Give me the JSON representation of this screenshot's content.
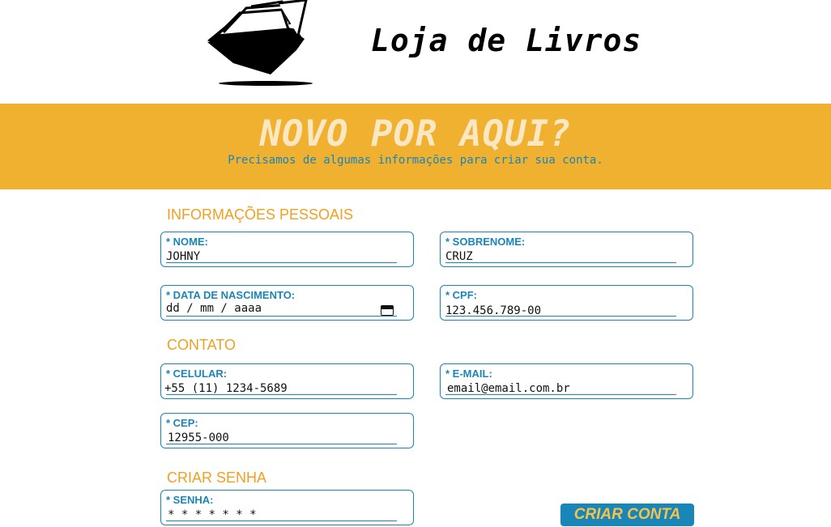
{
  "header": {
    "title": "Loja de Livros"
  },
  "banner": {
    "title": "NOVO POR AQUI?",
    "subtitle": "Precisamos de algumas informações para criar sua conta."
  },
  "sections": {
    "personal": "INFORMAÇÕES PESSOAIS",
    "contact": "CONTATO",
    "password": "CRIAR SENHA"
  },
  "fields": {
    "nome": {
      "label": "* NOME:",
      "value": "JOHNY"
    },
    "sobrenome": {
      "label": "* SOBRENOME:",
      "value": "CRUZ"
    },
    "nascimento": {
      "label": "* DATA DE NASCIMENTO:",
      "value": "dd / mm / aaaa"
    },
    "cpf": {
      "label": "* CPF:",
      "value": "123.456.789-00"
    },
    "celular": {
      "label": "* CELULAR:",
      "value": "+55 (11) 1234-5689"
    },
    "email": {
      "label": "* E-MAIL:",
      "value": "email@email.com.br"
    },
    "cep": {
      "label": "* CEP:",
      "value": "12955-000"
    },
    "senha": {
      "label": "* SENHA:",
      "value": "* * * * * * *"
    }
  },
  "submit": {
    "label": "CRIAR CONTA"
  },
  "colors": {
    "accent": "#f0b030",
    "primary": "#1a86b7",
    "banner_title": "#fbe7c2"
  },
  "icons": {
    "logo": "open-book-icon",
    "calendar": "calendar-icon"
  }
}
